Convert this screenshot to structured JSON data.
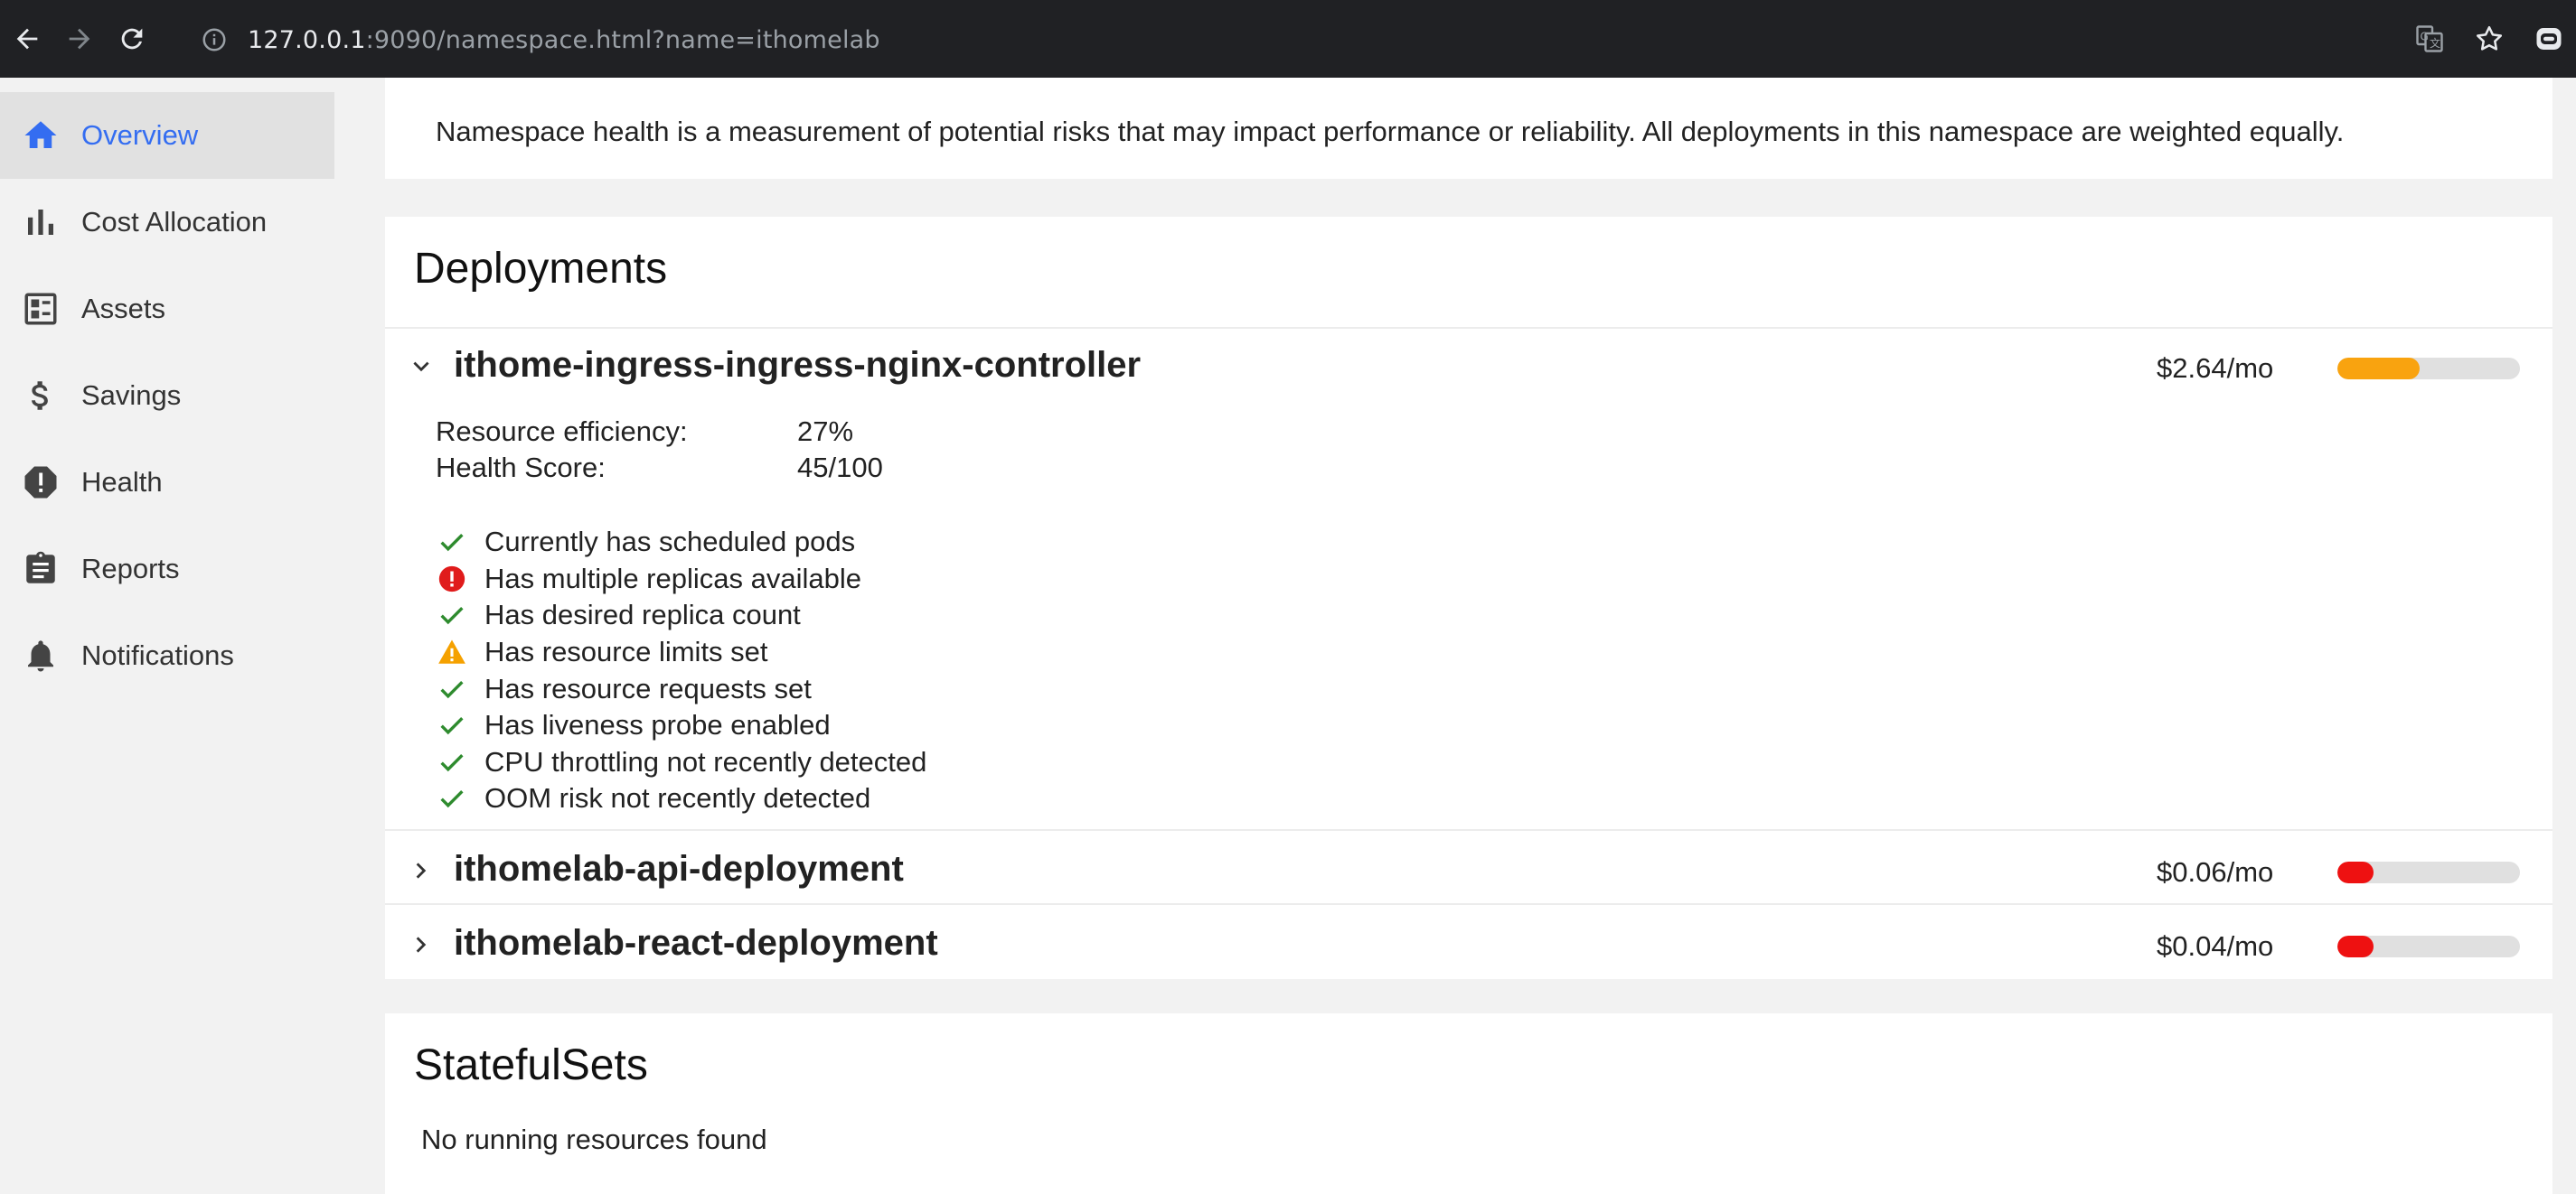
{
  "browser": {
    "url_host": "127.0.0.1",
    "url_rest": ":9090/namespace.html?name=ithomelab",
    "icons": [
      "back-arrow-icon",
      "forward-arrow-icon",
      "reload-icon",
      "info-icon",
      "translate-icon",
      "star-icon",
      "extension-icon"
    ]
  },
  "sidebar": {
    "items": [
      {
        "label": "Overview",
        "icon": "home-icon",
        "active": true
      },
      {
        "label": "Cost Allocation",
        "icon": "bar-chart-icon",
        "active": false
      },
      {
        "label": "Assets",
        "icon": "assets-icon",
        "active": false
      },
      {
        "label": "Savings",
        "icon": "dollar-icon",
        "active": false
      },
      {
        "label": "Health",
        "icon": "health-icon",
        "active": false
      },
      {
        "label": "Reports",
        "icon": "clipboard-icon",
        "active": false
      },
      {
        "label": "Notifications",
        "icon": "bell-icon",
        "active": false
      }
    ]
  },
  "info": {
    "text": "Namespace health is a measurement of potential risks that may impact performance or reliability. All deployments in this namespace are weighted equally."
  },
  "deployments": {
    "title": "Deployments",
    "items": [
      {
        "name": "ithome-ingress-ingress-nginx-controller",
        "cost": "$2.64/mo",
        "expanded": true,
        "health_fraction": 0.45,
        "bar_color": "#f9a30f",
        "efficiency_label": "Resource efficiency:",
        "efficiency_value": "27%",
        "health_label": "Health Score:",
        "health_value": "45/100",
        "checks": [
          {
            "status": "pass",
            "label": "Currently has scheduled pods"
          },
          {
            "status": "error",
            "label": "Has multiple replicas available"
          },
          {
            "status": "pass",
            "label": "Has desired replica count"
          },
          {
            "status": "warning",
            "label": "Has resource limits set"
          },
          {
            "status": "pass",
            "label": "Has resource requests set"
          },
          {
            "status": "pass",
            "label": "Has liveness probe enabled"
          },
          {
            "status": "pass",
            "label": "CPU throttling not recently detected"
          },
          {
            "status": "pass",
            "label": "OOM risk not recently detected"
          }
        ]
      },
      {
        "name": "ithomelab-api-deployment",
        "cost": "$0.06/mo",
        "expanded": false,
        "health_fraction": 0.2,
        "bar_color": "#ee1111"
      },
      {
        "name": "ithomelab-react-deployment",
        "cost": "$0.04/mo",
        "expanded": false,
        "health_fraction": 0.2,
        "bar_color": "#ee1111"
      }
    ]
  },
  "statefulsets": {
    "title": "StatefulSets",
    "empty": "No running resources found"
  },
  "colors": {
    "accent": "#346df1",
    "pass": "#2e8b2e",
    "error": "#e01b1b",
    "warning": "#f5a100"
  }
}
